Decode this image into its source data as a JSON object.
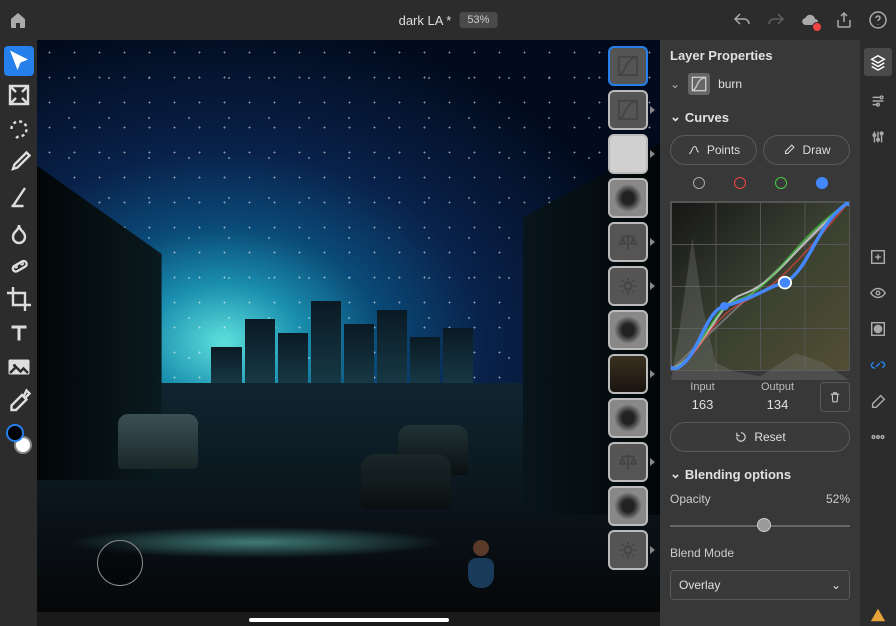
{
  "topbar": {
    "title": "dark LA *",
    "zoom": "53%"
  },
  "properties": {
    "panel_title": "Layer Properties",
    "layer_name": "burn",
    "sections": {
      "curves": "Curves",
      "blending": "Blending options"
    },
    "buttons": {
      "points": "Points",
      "draw": "Draw",
      "reset": "Reset"
    },
    "io": {
      "input_label": "Input",
      "input_value": "163",
      "output_label": "Output",
      "output_value": "134"
    },
    "opacity": {
      "label": "Opacity",
      "value": "52%",
      "pct": 52
    },
    "blend_mode": {
      "label": "Blend Mode",
      "value": "Overlay"
    }
  },
  "tools": [
    {
      "name": "move",
      "selected": true
    },
    {
      "name": "transform"
    },
    {
      "name": "lasso"
    },
    {
      "name": "brush"
    },
    {
      "name": "paint"
    },
    {
      "name": "eraser"
    },
    {
      "name": "fill"
    },
    {
      "name": "gradient"
    },
    {
      "name": "crop"
    },
    {
      "name": "type"
    },
    {
      "name": "place"
    },
    {
      "name": "eyedropper"
    }
  ],
  "layer_thumbs": [
    {
      "kind": "curves",
      "selected": true
    },
    {
      "kind": "curves"
    },
    {
      "kind": "image"
    },
    {
      "kind": "smudge"
    },
    {
      "kind": "balance"
    },
    {
      "kind": "exposure"
    },
    {
      "kind": "smudge"
    },
    {
      "kind": "image"
    },
    {
      "kind": "smudge"
    },
    {
      "kind": "balance"
    },
    {
      "kind": "smudge"
    },
    {
      "kind": "exposure"
    }
  ]
}
